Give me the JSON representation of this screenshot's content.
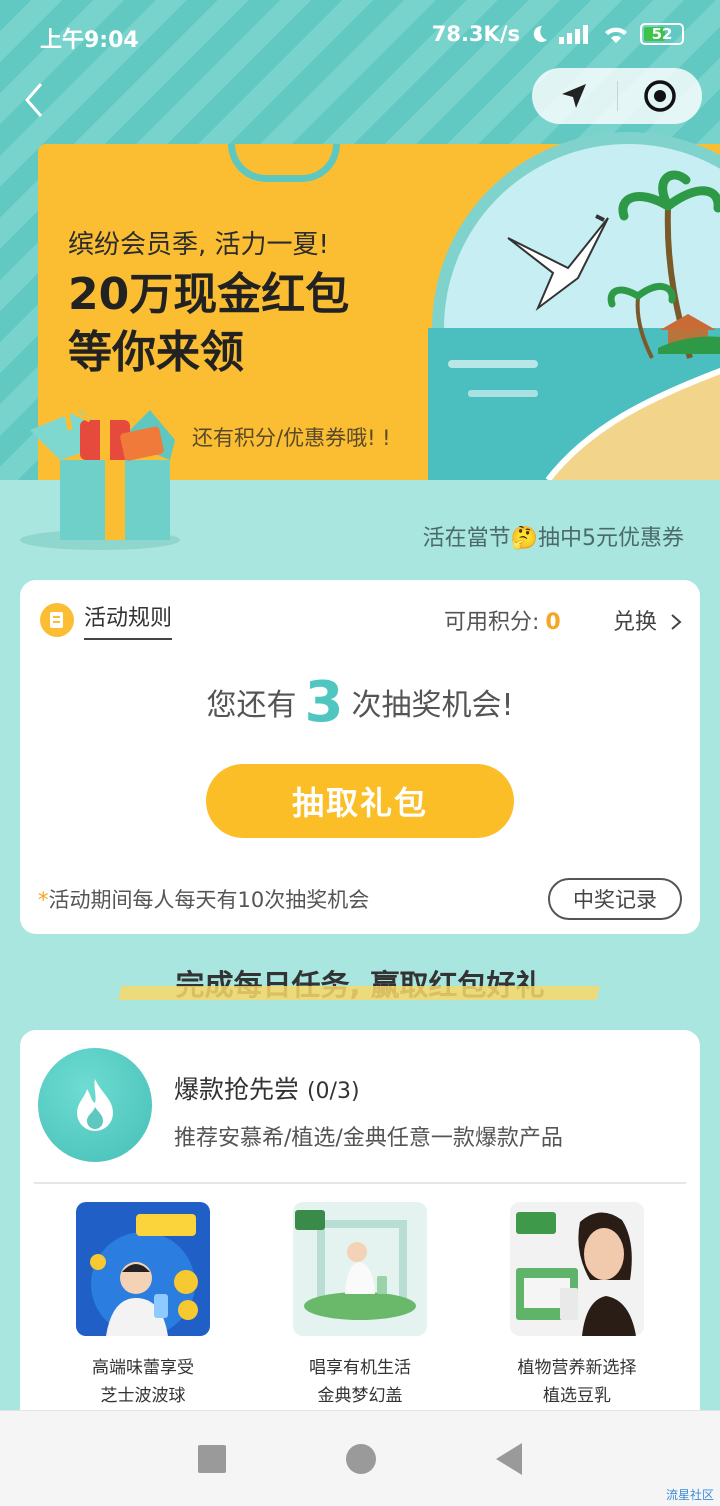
{
  "status_bar": {
    "time": "上午9:04",
    "network_speed": "78.3K/s",
    "battery": "52"
  },
  "nav": {
    "back_icon": "chevron-left-icon",
    "location_icon": "location-arrow-icon",
    "close_icon": "target-circle-icon"
  },
  "banner": {
    "subtitle": "缤纷会员季, 活力一夏!",
    "title_line1": "20万现金红包",
    "title_line2": "等你来领",
    "note": "还有积分/优惠券哦! !"
  },
  "tagline": "活在當节🤔抽中5元优惠券",
  "lottery": {
    "rules_label": "活动规则",
    "points_label": "可用积分:",
    "points_value": "0",
    "exchange_label": "兑换",
    "chances_prefix": "您还有",
    "chances_count": "3",
    "chances_suffix": "次抽奖机会!",
    "draw_button": "抽取礼包",
    "notice_star": "*",
    "notice": "活动期间每人每天有10次抽奖机会",
    "record_button": "中奖记录"
  },
  "section_title": "完成每日任务, 赢取红包好礼",
  "task": {
    "title": "爆款抢先尝",
    "count": "(0/3)",
    "desc": "推荐安慕希/植选/金典任意一款爆款产品",
    "products": [
      {
        "line1": "高端味蕾享受",
        "line2": "芝士波波球"
      },
      {
        "line1": "唱享有机生活",
        "line2": "金典梦幻盖"
      },
      {
        "line1": "植物营养新选择",
        "line2": "植选豆乳"
      }
    ]
  },
  "watermark": "流星社区",
  "colors": {
    "teal": "#5ec7c0",
    "yellow": "#fbbe33",
    "page_bg": "#a9e6df"
  }
}
